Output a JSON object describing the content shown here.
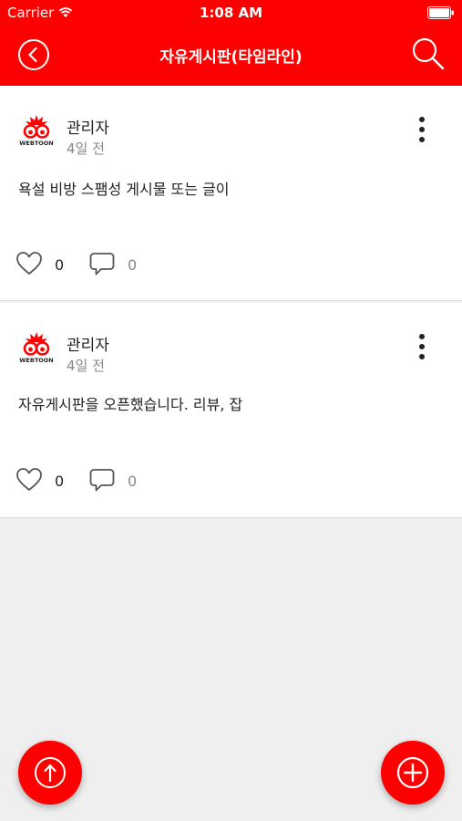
{
  "status_bar": {
    "carrier": "Carrier",
    "time": "1:08 AM"
  },
  "nav": {
    "title": "자유게시판(타임라인)"
  },
  "posts": [
    {
      "author": "관리자",
      "time": "4일 전",
      "text": "욕설 비방 스팸성 게시물 또는 글이",
      "likes": "0",
      "comments": "0"
    },
    {
      "author": "관리자",
      "time": "4일 전",
      "text": "자유게시판을 오픈했습니다. 리뷰, 잡",
      "likes": "0",
      "comments": "0"
    }
  ],
  "logo_text": "WEBTOON",
  "colors": {
    "accent": "#ff0000",
    "background": "#efefef"
  },
  "icons": [
    "wifi-icon",
    "battery-icon",
    "back-icon",
    "search-icon",
    "more-icon",
    "heart-icon",
    "comment-icon",
    "scroll-top-icon",
    "add-icon"
  ]
}
